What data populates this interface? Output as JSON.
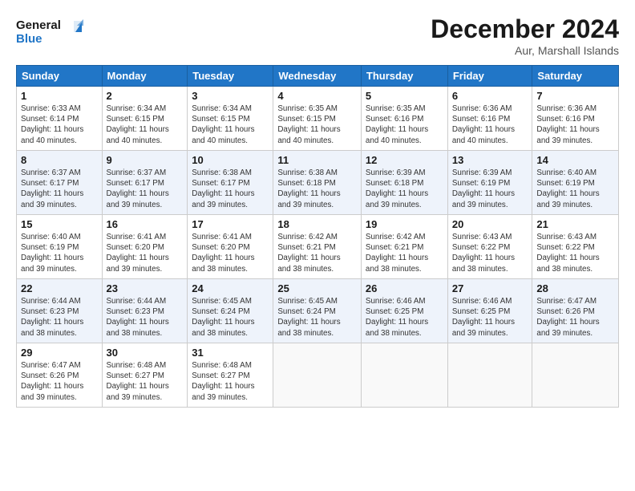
{
  "logo": {
    "line1": "General",
    "line2": "Blue"
  },
  "title": "December 2024",
  "location": "Aur, Marshall Islands",
  "days_of_week": [
    "Sunday",
    "Monday",
    "Tuesday",
    "Wednesday",
    "Thursday",
    "Friday",
    "Saturday"
  ],
  "weeks": [
    [
      {
        "day": "1",
        "info": "Sunrise: 6:33 AM\nSunset: 6:14 PM\nDaylight: 11 hours\nand 40 minutes."
      },
      {
        "day": "2",
        "info": "Sunrise: 6:34 AM\nSunset: 6:15 PM\nDaylight: 11 hours\nand 40 minutes."
      },
      {
        "day": "3",
        "info": "Sunrise: 6:34 AM\nSunset: 6:15 PM\nDaylight: 11 hours\nand 40 minutes."
      },
      {
        "day": "4",
        "info": "Sunrise: 6:35 AM\nSunset: 6:15 PM\nDaylight: 11 hours\nand 40 minutes."
      },
      {
        "day": "5",
        "info": "Sunrise: 6:35 AM\nSunset: 6:16 PM\nDaylight: 11 hours\nand 40 minutes."
      },
      {
        "day": "6",
        "info": "Sunrise: 6:36 AM\nSunset: 6:16 PM\nDaylight: 11 hours\nand 40 minutes."
      },
      {
        "day": "7",
        "info": "Sunrise: 6:36 AM\nSunset: 6:16 PM\nDaylight: 11 hours\nand 39 minutes."
      }
    ],
    [
      {
        "day": "8",
        "info": "Sunrise: 6:37 AM\nSunset: 6:17 PM\nDaylight: 11 hours\nand 39 minutes."
      },
      {
        "day": "9",
        "info": "Sunrise: 6:37 AM\nSunset: 6:17 PM\nDaylight: 11 hours\nand 39 minutes."
      },
      {
        "day": "10",
        "info": "Sunrise: 6:38 AM\nSunset: 6:17 PM\nDaylight: 11 hours\nand 39 minutes."
      },
      {
        "day": "11",
        "info": "Sunrise: 6:38 AM\nSunset: 6:18 PM\nDaylight: 11 hours\nand 39 minutes."
      },
      {
        "day": "12",
        "info": "Sunrise: 6:39 AM\nSunset: 6:18 PM\nDaylight: 11 hours\nand 39 minutes."
      },
      {
        "day": "13",
        "info": "Sunrise: 6:39 AM\nSunset: 6:19 PM\nDaylight: 11 hours\nand 39 minutes."
      },
      {
        "day": "14",
        "info": "Sunrise: 6:40 AM\nSunset: 6:19 PM\nDaylight: 11 hours\nand 39 minutes."
      }
    ],
    [
      {
        "day": "15",
        "info": "Sunrise: 6:40 AM\nSunset: 6:19 PM\nDaylight: 11 hours\nand 39 minutes."
      },
      {
        "day": "16",
        "info": "Sunrise: 6:41 AM\nSunset: 6:20 PM\nDaylight: 11 hours\nand 39 minutes."
      },
      {
        "day": "17",
        "info": "Sunrise: 6:41 AM\nSunset: 6:20 PM\nDaylight: 11 hours\nand 38 minutes."
      },
      {
        "day": "18",
        "info": "Sunrise: 6:42 AM\nSunset: 6:21 PM\nDaylight: 11 hours\nand 38 minutes."
      },
      {
        "day": "19",
        "info": "Sunrise: 6:42 AM\nSunset: 6:21 PM\nDaylight: 11 hours\nand 38 minutes."
      },
      {
        "day": "20",
        "info": "Sunrise: 6:43 AM\nSunset: 6:22 PM\nDaylight: 11 hours\nand 38 minutes."
      },
      {
        "day": "21",
        "info": "Sunrise: 6:43 AM\nSunset: 6:22 PM\nDaylight: 11 hours\nand 38 minutes."
      }
    ],
    [
      {
        "day": "22",
        "info": "Sunrise: 6:44 AM\nSunset: 6:23 PM\nDaylight: 11 hours\nand 38 minutes."
      },
      {
        "day": "23",
        "info": "Sunrise: 6:44 AM\nSunset: 6:23 PM\nDaylight: 11 hours\nand 38 minutes."
      },
      {
        "day": "24",
        "info": "Sunrise: 6:45 AM\nSunset: 6:24 PM\nDaylight: 11 hours\nand 38 minutes."
      },
      {
        "day": "25",
        "info": "Sunrise: 6:45 AM\nSunset: 6:24 PM\nDaylight: 11 hours\nand 38 minutes."
      },
      {
        "day": "26",
        "info": "Sunrise: 6:46 AM\nSunset: 6:25 PM\nDaylight: 11 hours\nand 38 minutes."
      },
      {
        "day": "27",
        "info": "Sunrise: 6:46 AM\nSunset: 6:25 PM\nDaylight: 11 hours\nand 39 minutes."
      },
      {
        "day": "28",
        "info": "Sunrise: 6:47 AM\nSunset: 6:26 PM\nDaylight: 11 hours\nand 39 minutes."
      }
    ],
    [
      {
        "day": "29",
        "info": "Sunrise: 6:47 AM\nSunset: 6:26 PM\nDaylight: 11 hours\nand 39 minutes."
      },
      {
        "day": "30",
        "info": "Sunrise: 6:48 AM\nSunset: 6:27 PM\nDaylight: 11 hours\nand 39 minutes."
      },
      {
        "day": "31",
        "info": "Sunrise: 6:48 AM\nSunset: 6:27 PM\nDaylight: 11 hours\nand 39 minutes."
      },
      null,
      null,
      null,
      null
    ]
  ]
}
